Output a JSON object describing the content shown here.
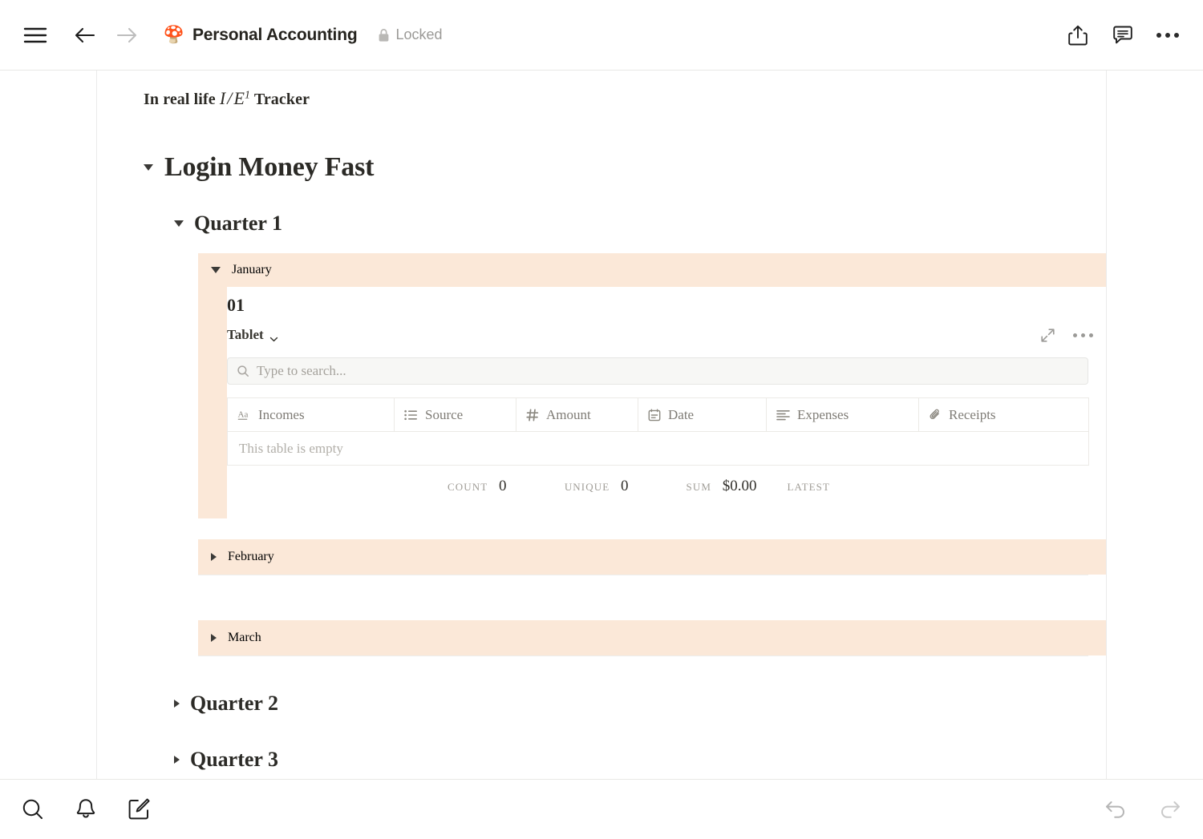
{
  "window": {
    "multitask_handle": "multitask-dots"
  },
  "topbar": {
    "menu_icon": "hamburger-menu-icon",
    "back_icon": "arrow-left-icon",
    "forward_icon": "arrow-right-icon",
    "doc_emoji": "🍄",
    "title": "Personal Accounting",
    "lock_icon": "lock-icon",
    "lock_label": "Locked",
    "share_icon": "share-icon",
    "comment_icon": "comment-icon",
    "more_icon": "more-horizontal-icon"
  },
  "document": {
    "caption": {
      "prefix": "In real life ",
      "var_one": "I",
      "slash": "/",
      "var_two": "E",
      "superscript": "1",
      "suffix": " Tracker"
    },
    "heading1": {
      "label": "Login Money Fast",
      "expanded": true
    },
    "quarters": [
      {
        "label": "Quarter 1",
        "expanded": true,
        "months": [
          {
            "label": "January",
            "expanded": true
          },
          {
            "label": "February",
            "expanded": false
          },
          {
            "label": "March",
            "expanded": false
          }
        ]
      },
      {
        "label": "Quarter 2",
        "expanded": false
      },
      {
        "label": "Quarter 3",
        "expanded": false
      }
    ],
    "january": {
      "day_heading": "01",
      "database": {
        "view_name": "Tablet",
        "view_chevron_icon": "chevron-down-icon",
        "expand_icon": "expand-diagonal-icon",
        "more_icon": "more-horizontal-icon",
        "search_placeholder": "Type to search...",
        "search_icon": "search-icon",
        "search_value": "",
        "columns": [
          {
            "label": "Incomes",
            "type_icon": "text-type-icon"
          },
          {
            "label": "Source",
            "type_icon": "select-list-icon"
          },
          {
            "label": "Amount",
            "type_icon": "number-hash-icon"
          },
          {
            "label": "Date",
            "type_icon": "calendar-icon"
          },
          {
            "label": "Expenses",
            "type_icon": "text-lines-icon"
          },
          {
            "label": "Receipts",
            "type_icon": "paperclip-icon"
          }
        ],
        "rows": [],
        "empty_message": "This table is empty",
        "aggregations": [
          {
            "column": "Incomes",
            "label": "",
            "value": ""
          },
          {
            "column": "Source",
            "label": "COUNT",
            "value": "0"
          },
          {
            "column": "Amount",
            "label": "UNIQUE",
            "value": "0"
          },
          {
            "column": "Date",
            "label": "SUM",
            "value": "$0.00"
          },
          {
            "column": "Expenses",
            "label": "LATEST",
            "value": ""
          },
          {
            "column": "Receipts",
            "label": "",
            "value": ""
          }
        ]
      }
    }
  },
  "bottombar": {
    "search_icon": "search-icon",
    "notifications_icon": "bell-icon",
    "new_note_icon": "compose-icon",
    "undo_icon": "undo-icon",
    "redo_icon": "redo-icon"
  },
  "colors": {
    "callout_background": "#fbe8d8",
    "text_primary": "#2b2a26",
    "text_muted": "#9b9a97"
  }
}
